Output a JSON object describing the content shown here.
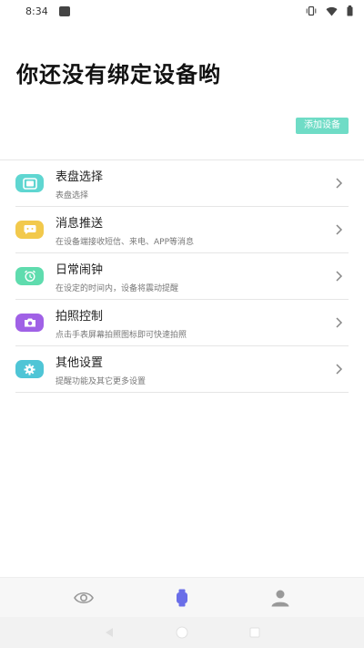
{
  "status_bar": {
    "time": "8:34",
    "icons": [
      "app-notification-icon",
      "vibrate-icon",
      "wifi-icon",
      "battery-icon"
    ]
  },
  "header": {
    "title": "你还没有绑定设备哟",
    "add_device_label": "添加设备"
  },
  "menu": {
    "items": [
      {
        "title": "表盘选择",
        "subtitle": "表盘选择",
        "icon": "watch-face-icon",
        "color": "#5fd6d1"
      },
      {
        "title": "消息推送",
        "subtitle": "在设备端接收短信、来电、APP等消息",
        "icon": "message-icon",
        "color": "#f2c94c"
      },
      {
        "title": "日常闹钟",
        "subtitle": "在设定的时间内，设备将震动提醒",
        "icon": "alarm-clock-icon",
        "color": "#5fdcae"
      },
      {
        "title": "拍照控制",
        "subtitle": "点击手表屏幕拍照图标即可快速拍照",
        "icon": "camera-icon",
        "color": "#a061e6"
      },
      {
        "title": "其他设置",
        "subtitle": "提醒功能及其它更多设置",
        "icon": "settings-gear-icon",
        "color": "#4fc5d6"
      }
    ]
  },
  "bottom_nav": {
    "items": [
      {
        "icon": "eye-icon",
        "active": false
      },
      {
        "icon": "watch-icon",
        "active": true
      },
      {
        "icon": "profile-icon",
        "active": false
      }
    ],
    "active_color": "#6a6ee8"
  },
  "system_nav": {
    "icons": [
      "back-icon",
      "home-icon",
      "recents-icon"
    ]
  }
}
